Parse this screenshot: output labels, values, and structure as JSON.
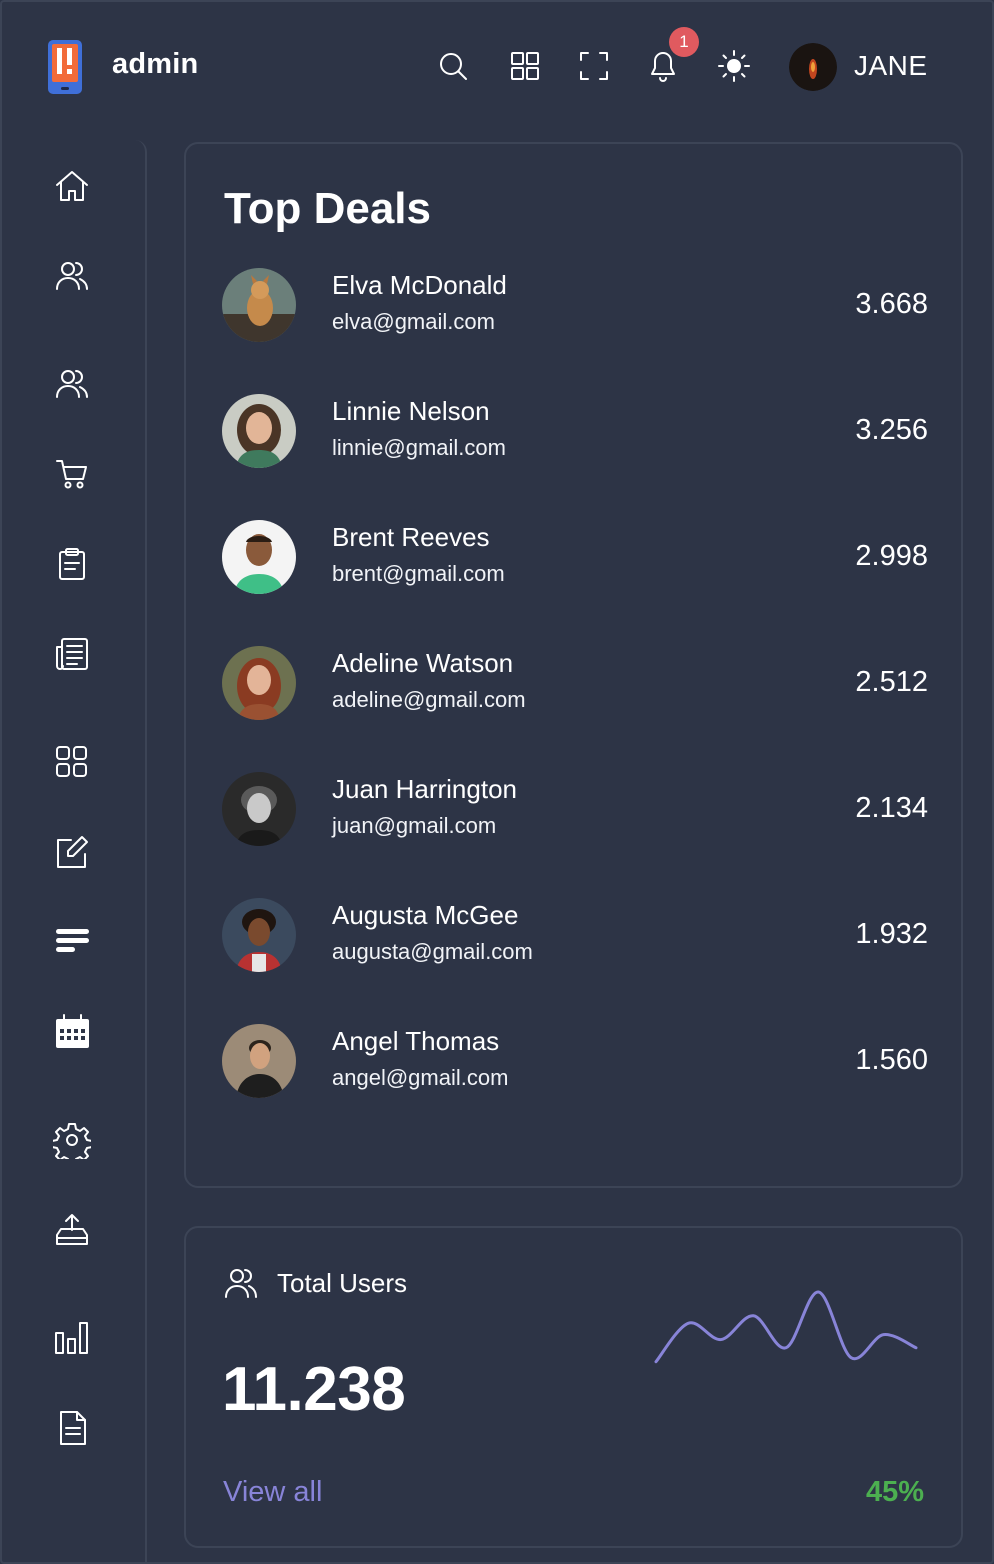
{
  "header": {
    "brand": "admin",
    "notification_count": "1",
    "user_name": "JANE",
    "icons": [
      "search-icon",
      "apps-icon",
      "fullscreen-icon",
      "bell-icon",
      "theme-sun-icon"
    ]
  },
  "sidebar": {
    "items": [
      {
        "icon": "home-icon"
      },
      {
        "icon": "users-icon"
      },
      {
        "icon": "users-icon"
      },
      {
        "icon": "cart-icon"
      },
      {
        "icon": "clipboard-icon"
      },
      {
        "icon": "news-icon"
      },
      {
        "icon": "grid-icon"
      },
      {
        "icon": "edit-icon"
      },
      {
        "icon": "list-icon"
      },
      {
        "icon": "calendar-icon"
      },
      {
        "icon": "gear-icon"
      },
      {
        "icon": "upload-icon"
      },
      {
        "icon": "bar-chart-icon"
      },
      {
        "icon": "document-icon"
      }
    ]
  },
  "top_deals": {
    "title": "Top Deals",
    "items": [
      {
        "name": "Elva McDonald",
        "email": "elva@gmail.com",
        "amount": "3.668"
      },
      {
        "name": "Linnie Nelson",
        "email": "linnie@gmail.com",
        "amount": "3.256"
      },
      {
        "name": "Brent Reeves",
        "email": "brent@gmail.com",
        "amount": "2.998"
      },
      {
        "name": "Adeline Watson",
        "email": "adeline@gmail.com",
        "amount": "2.512"
      },
      {
        "name": "Juan Harrington",
        "email": "juan@gmail.com",
        "amount": "2.134"
      },
      {
        "name": "Augusta McGee",
        "email": "augusta@gmail.com",
        "amount": "1.932"
      },
      {
        "name": "Angel Thomas",
        "email": "angel@gmail.com",
        "amount": "1.560"
      }
    ]
  },
  "total_users": {
    "title": "Total Users",
    "value": "11.238",
    "link": "View all",
    "percent": "45%",
    "sparkline": [
      0.15,
      0.62,
      0.42,
      0.71,
      0.32,
      1.0,
      0.2,
      0.48,
      0.32
    ],
    "line_color": "#8884d8"
  },
  "colors": {
    "background": "#2d3446",
    "border": "#3c4456",
    "accent": "#8884d8",
    "positive": "#4caf50",
    "badge": "#e05a5f"
  }
}
